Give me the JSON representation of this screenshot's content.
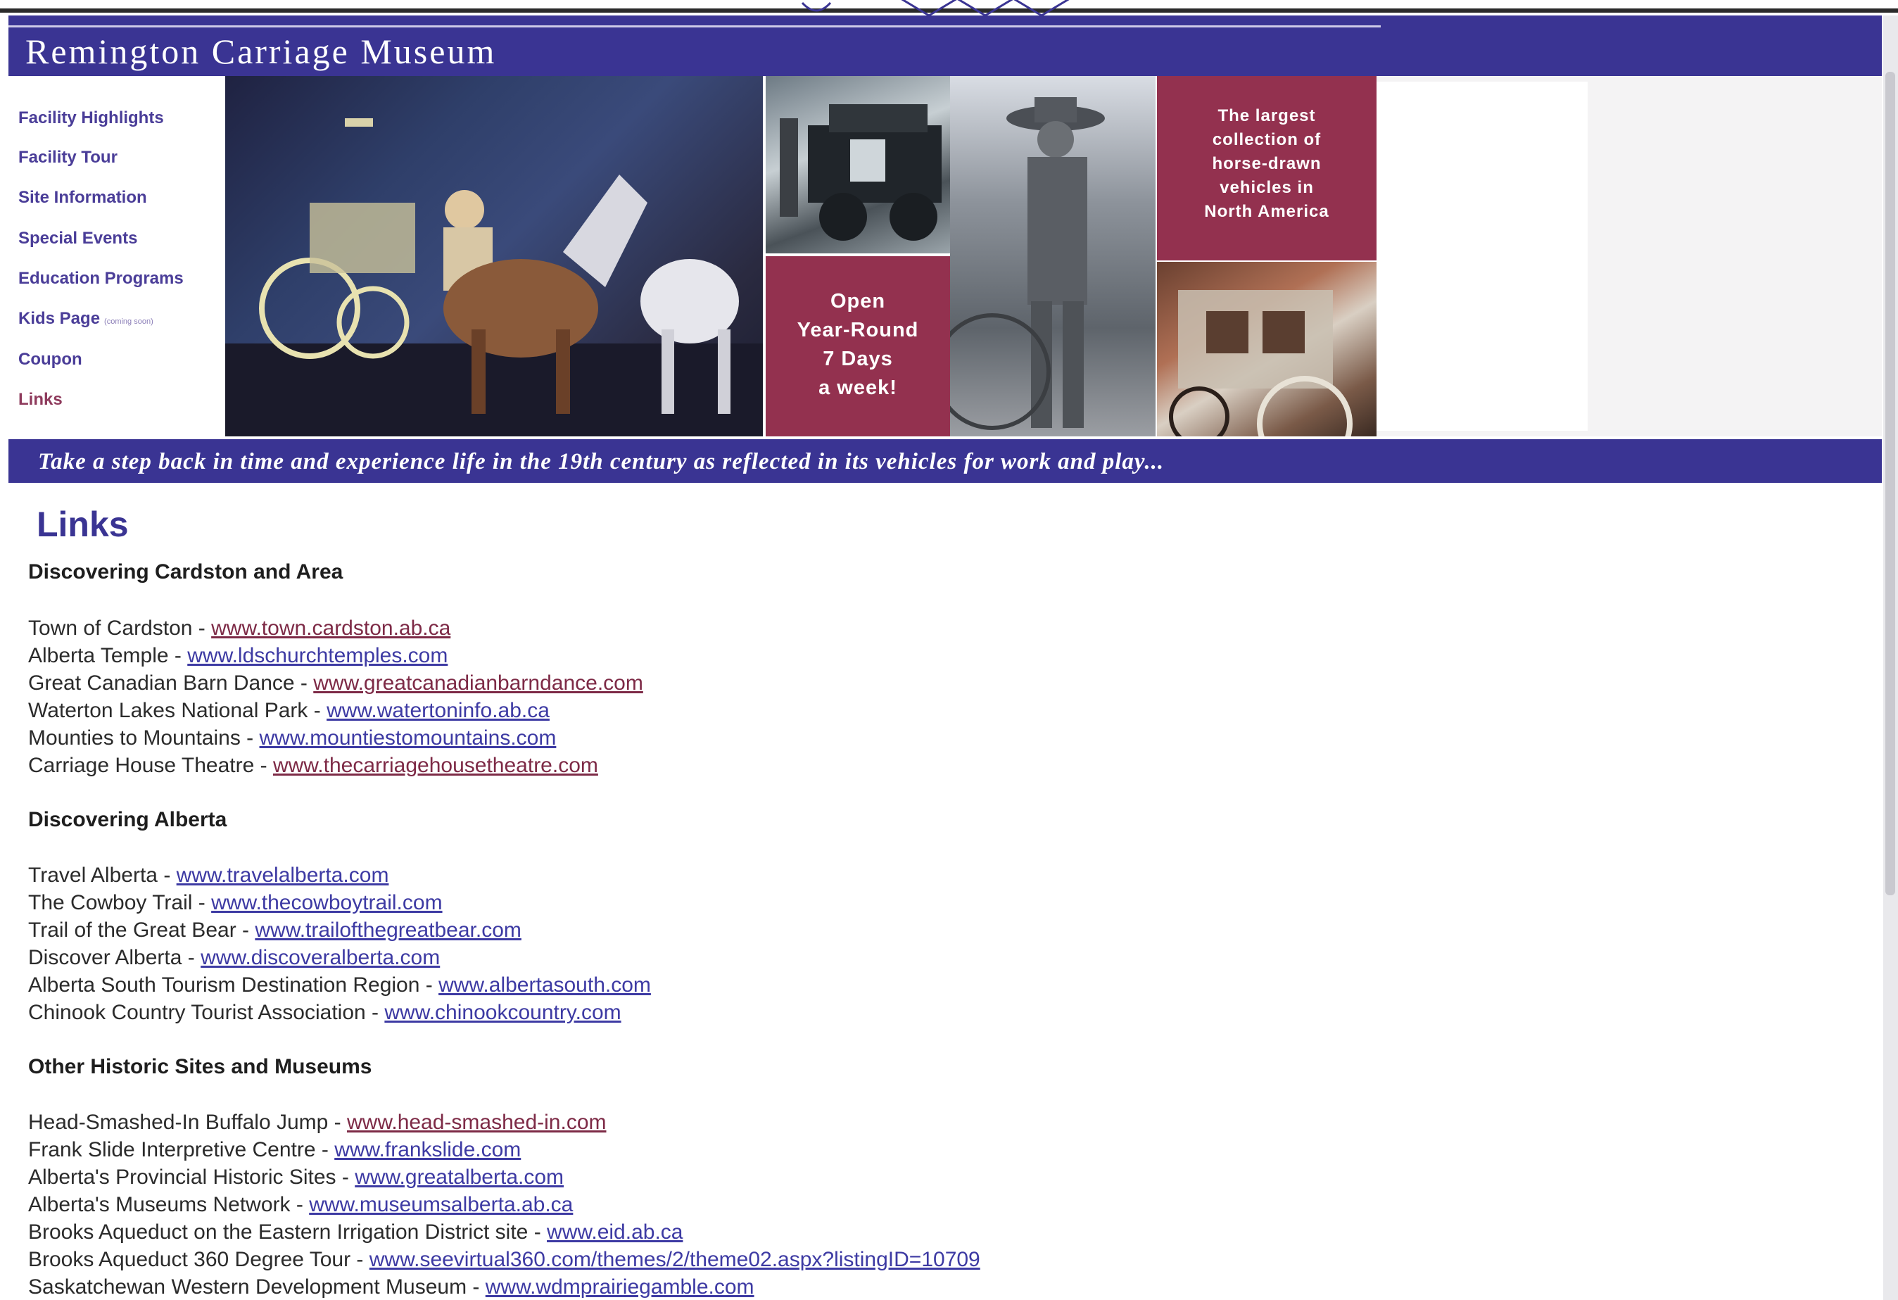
{
  "site": {
    "title": "Remington Carriage Museum",
    "tagline": "Take a step back in time and experience life in the 19th century as reflected in its vehicles for work and play..."
  },
  "nav": [
    {
      "label": "Facility Highlights"
    },
    {
      "label": "Facility Tour"
    },
    {
      "label": "Site Information"
    },
    {
      "label": "Special Events"
    },
    {
      "label": "Education Programs"
    },
    {
      "label": "Kids Page",
      "note": "(coming soon)"
    },
    {
      "label": "Coupon"
    },
    {
      "label": "Links"
    }
  ],
  "banner": {
    "open_lines": [
      "Open",
      "Year-Round",
      "7 Days",
      "a week!"
    ],
    "largest_lines": [
      "The largest",
      "collection of",
      "horse-drawn",
      "vehicles in",
      "North America"
    ]
  },
  "page": {
    "heading": "Links",
    "sections": [
      {
        "heading": "Discovering Cardston and Area",
        "links": [
          {
            "name": "Town of Cardston",
            "url": "www.town.cardston.ab.ca"
          },
          {
            "name": "Alberta Temple",
            "url": "www.ldschurchtemples.com"
          },
          {
            "name": "Great Canadian Barn Dance",
            "url": "www.greatcanadianbarndance.com"
          },
          {
            "name": "Waterton Lakes National Park",
            "url": "www.watertoninfo.ab.ca"
          },
          {
            "name": "Mounties to Mountains",
            "url": "www.mountiestomountains.com"
          },
          {
            "name": "Carriage House Theatre",
            "url": "www.thecarriagehousetheatre.com"
          }
        ]
      },
      {
        "heading": "Discovering Alberta",
        "links": [
          {
            "name": "Travel Alberta",
            "url": "www.travelalberta.com"
          },
          {
            "name": "The Cowboy Trail",
            "url": "www.thecowboytrail.com"
          },
          {
            "name": "Trail of the Great Bear",
            "url": "www.trailofthegreatbear.com"
          },
          {
            "name": "Discover Alberta",
            "url": "www.discoveralberta.com"
          },
          {
            "name": "Alberta South Tourism Destination Region",
            "url": "www.albertasouth.com"
          },
          {
            "name": "Chinook Country Tourist Association",
            "url": "www.chinookcountry.com"
          }
        ]
      },
      {
        "heading": "Other Historic Sites and Museums",
        "links": [
          {
            "name": "Head-Smashed-In Buffalo Jump",
            "url": "www.head-smashed-in.com"
          },
          {
            "name": "Frank Slide Interpretive Centre",
            "url": "www.frankslide.com"
          },
          {
            "name": "Alberta's Provincial Historic Sites",
            "url": "www.greatalberta.com"
          },
          {
            "name": "Alberta's Museums Network",
            "url": "www.museumsalberta.ab.ca"
          },
          {
            "name": "Brooks Aqueduct on the Eastern Irrigation District site",
            "url": "www.eid.ab.ca"
          },
          {
            "name": "Brooks Aqueduct 360 Degree Tour",
            "url": "www.seevirtual360.com/themes/2/theme02.aspx?listingID=10709"
          },
          {
            "name": "Saskatchewan Western Development Museum",
            "url": "www.wdmprairiegamble.com"
          }
        ]
      }
    ]
  },
  "colors": {
    "header_bg": "#3a3493",
    "tile_bg": "#93314f",
    "link": "#3d3aa3",
    "visited_link": "#7d2a46"
  }
}
